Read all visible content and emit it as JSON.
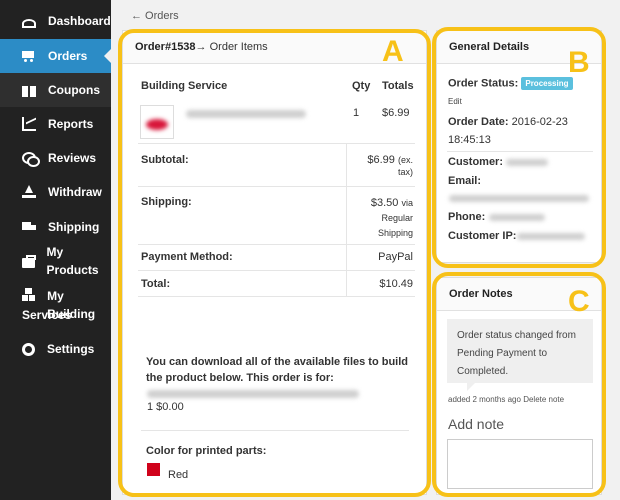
{
  "sidebar": {
    "items": [
      {
        "label": "Dashboard"
      },
      {
        "label": "Orders"
      },
      {
        "label": "Coupons"
      },
      {
        "label": "Reports"
      },
      {
        "label": "Reviews"
      },
      {
        "label": "Withdraw"
      },
      {
        "label": "Shipping"
      },
      {
        "label": "My Products"
      },
      {
        "label": "My Building",
        "label2": "Services"
      },
      {
        "label": "Settings"
      }
    ]
  },
  "breadcrumb": "← Orders",
  "order_items": {
    "title_order": "Order#1538",
    "title_rest": " → Order Items",
    "col_service": "Building Service",
    "col_qty": "Qty",
    "col_totals": "Totals",
    "item_qty": "1",
    "item_total": "$6.99",
    "subtotal_label": "Subtotal:",
    "subtotal_value": "$6.99",
    "subtotal_note_1": "(ex.",
    "subtotal_note_2": "tax)",
    "shipping_label": "Shipping:",
    "shipping_value": "$3.50",
    "shipping_via": "via",
    "shipping_method_1": "Regular",
    "shipping_method_2": "Shipping",
    "payment_label": "Payment Method:",
    "payment_value": "PayPal",
    "total_label": "Total:",
    "total_value": "$10.49",
    "download_text_1": "You can download all of the available files to build",
    "download_text_2": "the product below. This order is for:",
    "download_price": "1 $0.00",
    "color_label": "Color for printed parts:",
    "color_value": "Red",
    "color_swatch": "#d0021b"
  },
  "general": {
    "title": "General Details",
    "status_label": "Order Status:",
    "status_value": "Processing",
    "edit_label": "Edit",
    "date_label": "Order Date:",
    "date_value": "2016-02-23",
    "time_value": "18:45:13",
    "customer_label": "Customer:",
    "email_label": "Email:",
    "phone_label": "Phone:",
    "ip_label": "Customer IP:"
  },
  "notes": {
    "title": "Order Notes",
    "note_1": "Order status changed from",
    "note_2": "Pending Payment to",
    "note_3": "Completed.",
    "meta": "added 2 months ago",
    "delete_label": "Delete note",
    "add_note_label": "Add note"
  },
  "markers": {
    "a": "A",
    "b": "B",
    "c": "C"
  },
  "colors": {
    "highlight": "#f7c118",
    "accent": "#2c8cc6",
    "badge": "#5bc0de"
  }
}
